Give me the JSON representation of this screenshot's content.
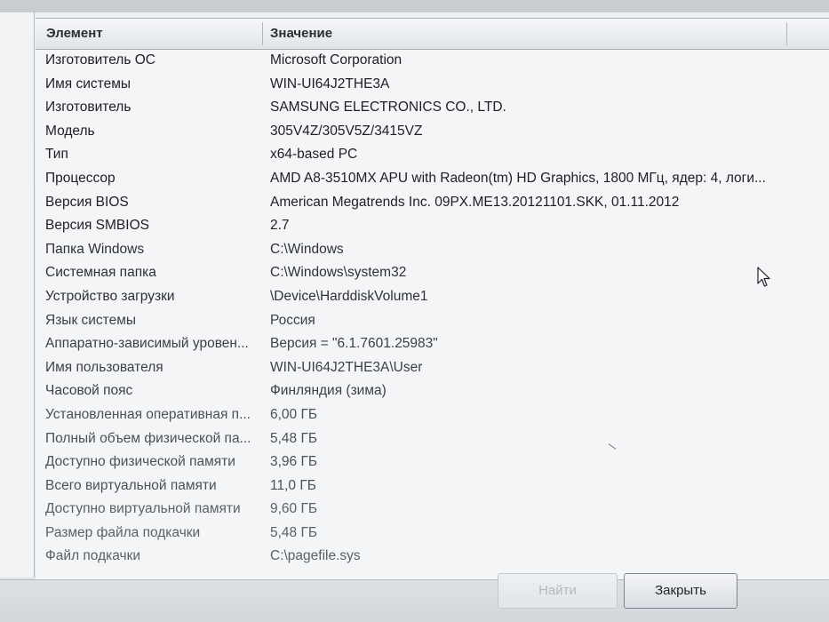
{
  "header": {
    "col_element": "Элемент",
    "col_value": "Значение"
  },
  "rows": [
    {
      "k": "Изготовитель ОС",
      "v": "Microsoft Corporation"
    },
    {
      "k": "Имя системы",
      "v": "WIN-UI64J2THE3A"
    },
    {
      "k": "Изготовитель",
      "v": "SAMSUNG ELECTRONICS CO., LTD."
    },
    {
      "k": "Модель",
      "v": "305V4Z/305V5Z/3415VZ"
    },
    {
      "k": "Тип",
      "v": "x64-based PC"
    },
    {
      "k": "Процессор",
      "v": "AMD A8-3510MX APU with Radeon(tm) HD Graphics, 1800 МГц, ядер: 4, логи..."
    },
    {
      "k": "Версия BIOS",
      "v": "American Megatrends Inc. 09PX.ME13.20121101.SKK, 01.11.2012"
    },
    {
      "k": "Версия SMBIOS",
      "v": "2.7"
    },
    {
      "k": "Папка Windows",
      "v": "C:\\Windows"
    },
    {
      "k": "Системная папка",
      "v": "C:\\Windows\\system32"
    },
    {
      "k": "Устройство загрузки",
      "v": "\\Device\\HarddiskVolume1"
    },
    {
      "k": "Язык системы",
      "v": "Россия"
    },
    {
      "k": "Аппаратно-зависимый уровен...",
      "v": "Версия = \"6.1.7601.25983\""
    },
    {
      "k": "Имя пользователя",
      "v": "WIN-UI64J2THE3A\\User"
    },
    {
      "k": "Часовой пояс",
      "v": "Финляндия (зима)"
    },
    {
      "k": "Установленная оперативная п...",
      "v": "6,00 ГБ"
    },
    {
      "k": "Полный объем физической па...",
      "v": "5,48 ГБ"
    },
    {
      "k": "Доступно физической памяти",
      "v": "3,96 ГБ"
    },
    {
      "k": "Всего виртуальной памяти",
      "v": "11,0 ГБ"
    },
    {
      "k": "Доступно виртуальной памяти",
      "v": "9,60 ГБ"
    },
    {
      "k": "Размер файла подкачки",
      "v": "5,48 ГБ"
    },
    {
      "k": "Файл подкачки",
      "v": "C:\\pagefile.sys"
    }
  ],
  "buttons": {
    "find_label": "Найти",
    "close_label": "Закрыть"
  }
}
